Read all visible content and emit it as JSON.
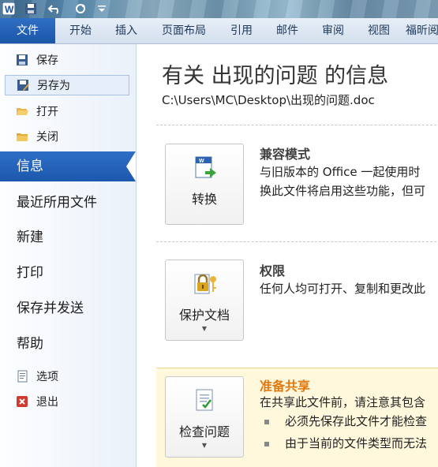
{
  "quick_access": {
    "word_icon": "word-app-icon",
    "save_icon": "save-icon",
    "undo_icon": "undo-icon",
    "redo_icon": "redo-icon"
  },
  "ribbon": {
    "tabs": [
      {
        "label": "文件"
      },
      {
        "label": "开始"
      },
      {
        "label": "插入"
      },
      {
        "label": "页面布局"
      },
      {
        "label": "引用"
      },
      {
        "label": "邮件"
      },
      {
        "label": "审阅"
      },
      {
        "label": "视图"
      },
      {
        "label": "福昕阅"
      }
    ]
  },
  "sidebar": {
    "small_top": [
      {
        "label": "保存",
        "icon": "save-icon"
      },
      {
        "label": "另存为",
        "icon": "save-as-icon"
      },
      {
        "label": "打开",
        "icon": "open-folder-icon"
      },
      {
        "label": "关闭",
        "icon": "close-folder-icon"
      }
    ],
    "large": [
      {
        "label": "信息"
      },
      {
        "label": "最近所用文件"
      },
      {
        "label": "新建"
      },
      {
        "label": "打印"
      },
      {
        "label": "保存并发送"
      },
      {
        "label": "帮助"
      }
    ],
    "small_bottom": [
      {
        "label": "选项",
        "icon": "options-icon"
      },
      {
        "label": "退出",
        "icon": "exit-icon"
      }
    ]
  },
  "main": {
    "title": "有关 出现的问题 的信息",
    "path": "C:\\Users\\MC\\Desktop\\出现的问题.doc",
    "sections": [
      {
        "button_label": "转换",
        "icon": "convert-document-icon",
        "title": "兼容模式",
        "lines": [
          "与旧版本的 Office 一起使用时",
          "换此文件将启用这些功能，但可"
        ]
      },
      {
        "button_label": "保护文档",
        "icon": "protect-document-icon",
        "title": "权限",
        "lines": [
          "任何人均可打开、复制和更改此"
        ]
      },
      {
        "button_label": "检查问题",
        "icon": "check-issues-icon",
        "title": "准备共享",
        "lines": [
          "在共享此文件前，请注意其包含"
        ],
        "bullets": [
          "必须先保存此文件才能检查",
          "由于当前的文件类型而无法"
        ]
      }
    ]
  },
  "colors": {
    "file_tab": "#1b56a8",
    "selected_nav": "#2e6fc6",
    "share_title": "#e07a10",
    "share_bg": "#fff8dc"
  }
}
